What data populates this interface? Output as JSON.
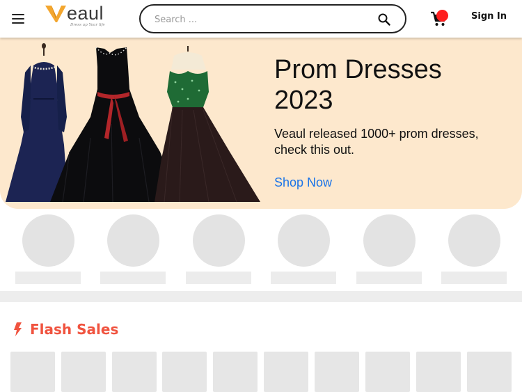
{
  "header": {
    "logo": {
      "word": "eaul",
      "tagline": "Dress up Your life",
      "brand_color": "#f3a62e"
    },
    "search": {
      "placeholder": "Search ...",
      "value": ""
    },
    "sign_in_label": "Sign In",
    "cart_badge_color": "#ff1f1f"
  },
  "banner": {
    "title_line1": "Prom Dresses",
    "title_line2": "2023",
    "subtitle_line1": "Veaul released 1000+ prom dresses,",
    "subtitle_line2": "check this out.",
    "cta_label": "Shop Now",
    "background": "#fde8cd",
    "cta_color": "#1a73e8"
  },
  "categories": {
    "count": 6,
    "state": "loading-placeholder"
  },
  "flash_sales": {
    "title": "Flash Sales",
    "accent": "#f0533f",
    "product_count": 10,
    "state": "loading-placeholder"
  }
}
